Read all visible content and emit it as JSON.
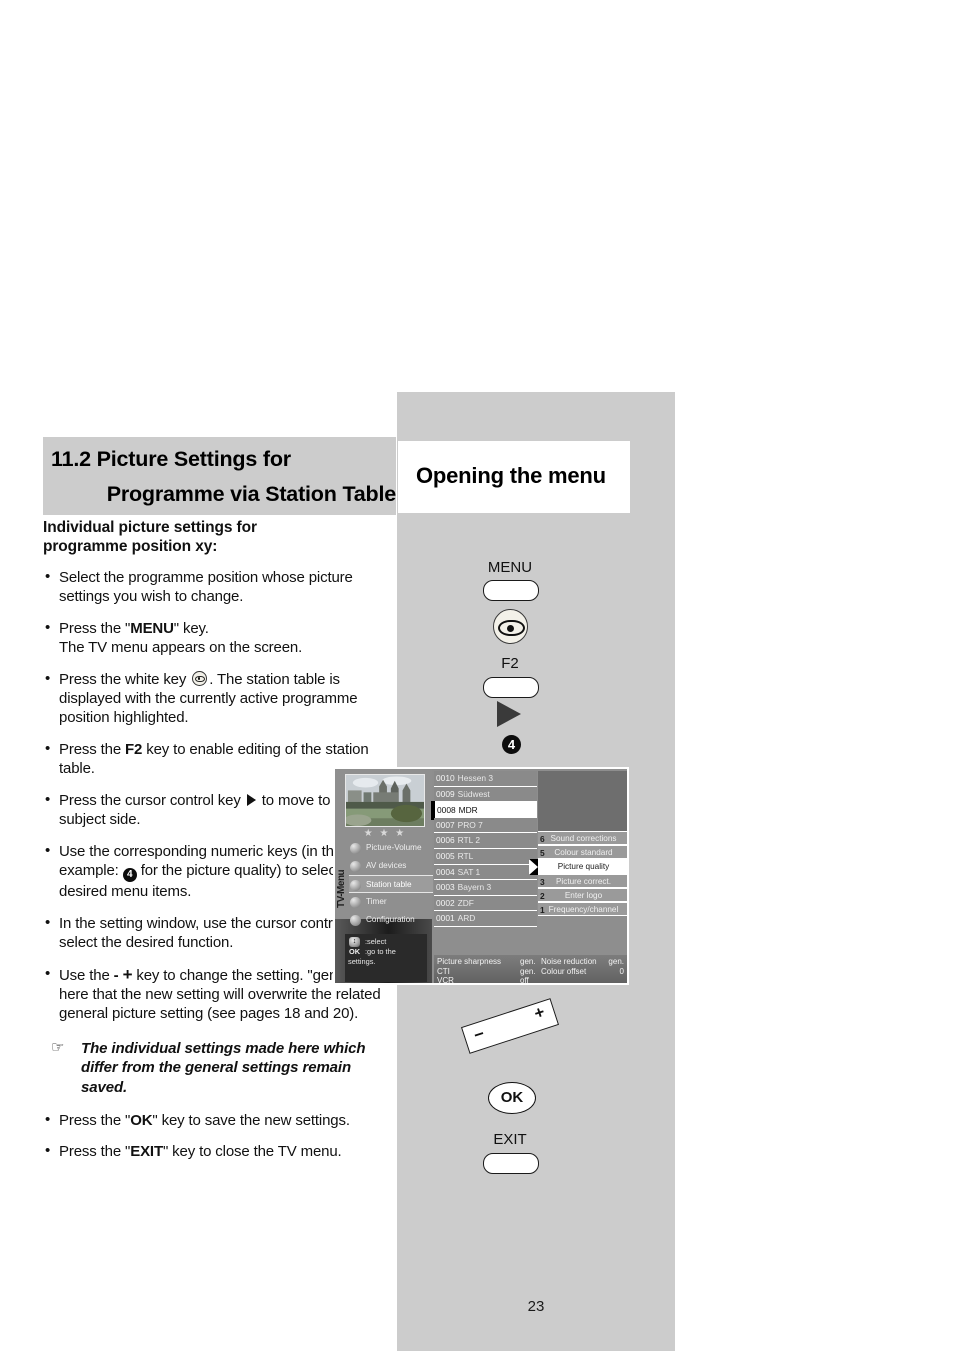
{
  "page": {
    "number": "23"
  },
  "section": {
    "number_title_line1": "11.2 Picture Settings for",
    "number_title_line2": "Programme via Station Table",
    "right_title": "Opening the menu"
  },
  "left_column": {
    "subheading_line1": "Individual picture settings for",
    "subheading_line2": "programme position xy:",
    "bullets": [
      "Select the programme position whose picture settings you wish to change.",
      "Press the \"MENU\" key. The TV menu appears on the screen.",
      "Press the white key . The station table is displayed with the currently active programme position highlighted.",
      "Press the F2 key to enable editing of the station table.",
      "Press the cursor control key  to move to the subject side.",
      "Use the corresponding numeric keys (in this example:  for the picture quality) to select the desired menu items.",
      "In the setting window, use the cursor control key to select the desired function.",
      "Use the - + key to change the setting. \"gen.\" means here that the new setting will overwrite the related general picture setting (see pages 18 and 20).",
      "Press the \"OK\" key to save the new settings.",
      "Press the \"EXIT\" key to close the TV menu."
    ],
    "note": "The individual settings made here which differ from the general settings remain saved.",
    "note_icon": "pointing-hand-icon"
  },
  "remote": {
    "menu_label": "MENU",
    "white_key_icon": "eye-icon",
    "f2_label": "F2",
    "cursor_right_icon": "triangle-right-icon",
    "numeric_key": "4",
    "rocker_plus": "+",
    "rocker_minus": "−",
    "ok_label": "OK",
    "exit_label": "EXIT"
  },
  "tv_screen": {
    "vertical_label": "TV-Menu",
    "stars": "★ ★ ★",
    "left_menu": [
      {
        "label": "Picture-Volume",
        "selected": false
      },
      {
        "label": "AV devices",
        "selected": false
      },
      {
        "label": "Station table",
        "selected": true
      },
      {
        "label": "Timer",
        "selected": false
      },
      {
        "label": "Configuration",
        "selected": false
      }
    ],
    "hint": {
      "select_line": ":select",
      "ok_key": "OK",
      "ok_line": ":go to the",
      "ok_line2": "settings."
    },
    "station_table": [
      {
        "number": "0010",
        "name": "Hessen 3",
        "selected": false
      },
      {
        "number": "0009",
        "name": "Südwest",
        "selected": false
      },
      {
        "number": "0008",
        "name": "MDR",
        "selected": true
      },
      {
        "number": "0007",
        "name": "PRO 7",
        "selected": false
      },
      {
        "number": "0006",
        "name": "RTL 2",
        "selected": false
      },
      {
        "number": "0005",
        "name": "RTL",
        "selected": false
      },
      {
        "number": "0004",
        "name": "SAT 1",
        "selected": false
      },
      {
        "number": "0003",
        "name": "Bayern 3",
        "selected": false
      },
      {
        "number": "0002",
        "name": "ZDF",
        "selected": false
      },
      {
        "number": "0001",
        "name": "ARD",
        "selected": false
      }
    ],
    "subject_menu": [
      {
        "index": "6",
        "label": "Sound corrections",
        "selected": false
      },
      {
        "index": "5",
        "label": "Colour standard",
        "selected": false
      },
      {
        "index": "",
        "label": "Picture quality",
        "selected": true
      },
      {
        "index": "3",
        "label": "Picture correct.",
        "selected": false
      },
      {
        "index": "2",
        "label": "Enter logo",
        "selected": false
      },
      {
        "index": "1",
        "label": "Frequency/channel",
        "selected": false
      }
    ],
    "settings_bar": {
      "row1": {
        "label_a": "Picture sharpness",
        "value_a": "gen.",
        "label_b": "Noise reduction",
        "value_b": "gen."
      },
      "row2": {
        "label_a": "CTI",
        "value_a": "gen.",
        "label_b": "Colour offset",
        "value_b": "0"
      },
      "row3": {
        "label_a": "VCR",
        "value_a": "off",
        "label_b": "",
        "value_b": ""
      }
    }
  },
  "colors": {
    "panel_grey": "#cccccc",
    "tv_grey": "#8e8e8e",
    "highlight_white": "#ffffff",
    "text_black": "#111111"
  }
}
